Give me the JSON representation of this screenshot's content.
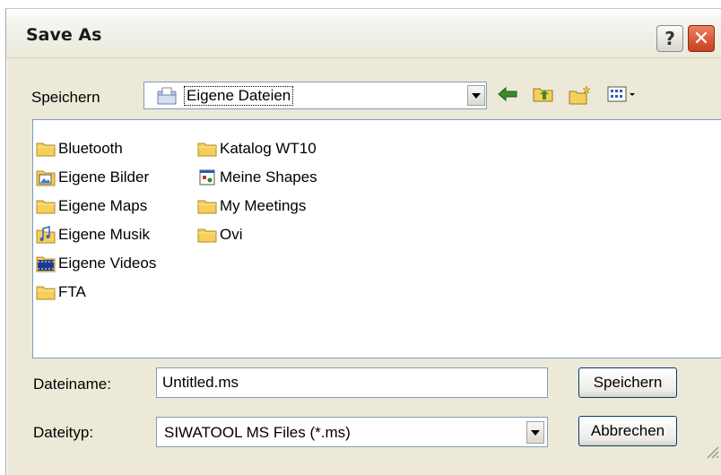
{
  "window": {
    "title": "Save As"
  },
  "title_buttons": {
    "help": "?",
    "close": "✕"
  },
  "save_in": {
    "label": "Speichern",
    "value": "Eigene Dateien"
  },
  "toolbar": {
    "back_icon": "back-arrow-icon",
    "up_icon": "up-folder-icon",
    "new_folder_icon": "new-folder-icon",
    "view_icon": "view-menu-icon"
  },
  "files": [
    {
      "name": "Bluetooth",
      "icon": "folder-icon"
    },
    {
      "name": "Eigene Bilder",
      "icon": "pictures-folder-icon"
    },
    {
      "name": "Eigene Maps",
      "icon": "folder-icon"
    },
    {
      "name": "Eigene Musik",
      "icon": "music-folder-icon"
    },
    {
      "name": "Eigene Videos",
      "icon": "video-folder-icon"
    },
    {
      "name": "FTA",
      "icon": "folder-icon"
    },
    {
      "name": "Katalog WT10",
      "icon": "folder-icon"
    },
    {
      "name": "Meine Shapes",
      "icon": "shapes-folder-icon"
    },
    {
      "name": "My Meetings",
      "icon": "folder-icon"
    },
    {
      "name": "Ovi",
      "icon": "folder-icon"
    }
  ],
  "filename": {
    "label": "Dateiname:",
    "value": "Untitled.ms"
  },
  "filetype": {
    "label": "Dateityp:",
    "value": "SIWATOOL MS Files (*.ms)"
  },
  "buttons": {
    "save": "Speichern",
    "cancel": "Abbrechen"
  },
  "colors": {
    "folder": "#f5cf5a",
    "close": "#d4532f",
    "border": "#7f9db9"
  }
}
